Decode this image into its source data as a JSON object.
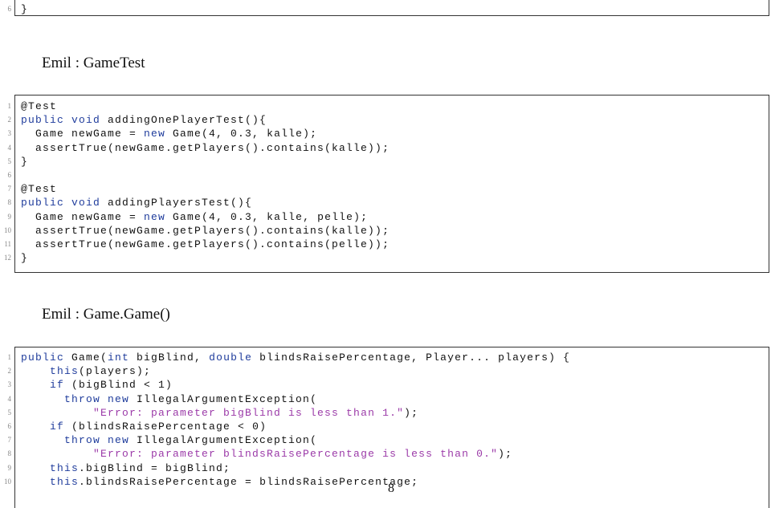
{
  "colors": {
    "keyword": "#1f3c9c",
    "string": "#9b3aa8"
  },
  "listing1": {
    "lines": [
      {
        "n": "6",
        "tokens": [
          [
            "}",
            "p"
          ]
        ]
      }
    ]
  },
  "heading1": "Emil : GameTest",
  "listing2": {
    "lines": [
      {
        "n": "1",
        "tokens": [
          [
            "@Test",
            "p"
          ]
        ]
      },
      {
        "n": "2",
        "tokens": [
          [
            "public void",
            "kw"
          ],
          [
            " addingOnePlayerTest(){",
            "p"
          ]
        ]
      },
      {
        "n": "3",
        "tokens": [
          [
            "  Game newGame = ",
            "p"
          ],
          [
            "new",
            "kw"
          ],
          [
            " Game(4, 0.3, kalle);",
            "p"
          ]
        ]
      },
      {
        "n": "4",
        "tokens": [
          [
            "  assertTrue(newGame.getPlayers().contains(kalle));",
            "p"
          ]
        ]
      },
      {
        "n": "5",
        "tokens": [
          [
            "}",
            "p"
          ]
        ]
      },
      {
        "n": "6",
        "tokens": []
      },
      {
        "n": "7",
        "tokens": [
          [
            "@Test",
            "p"
          ]
        ]
      },
      {
        "n": "8",
        "tokens": [
          [
            "public void",
            "kw"
          ],
          [
            " addingPlayersTest(){",
            "p"
          ]
        ]
      },
      {
        "n": "9",
        "tokens": [
          [
            "  Game newGame = ",
            "p"
          ],
          [
            "new",
            "kw"
          ],
          [
            " Game(4, 0.3, kalle, pelle);",
            "p"
          ]
        ]
      },
      {
        "n": "10",
        "tokens": [
          [
            "  assertTrue(newGame.getPlayers().contains(kalle));",
            "p"
          ]
        ]
      },
      {
        "n": "11",
        "tokens": [
          [
            "  assertTrue(newGame.getPlayers().contains(pelle));",
            "p"
          ]
        ]
      },
      {
        "n": "12",
        "tokens": [
          [
            "}",
            "p"
          ]
        ]
      }
    ]
  },
  "heading2": "Emil : Game.Game()",
  "listing3": {
    "lines": [
      {
        "n": "1",
        "tokens": [
          [
            "public",
            "kw"
          ],
          [
            " Game(",
            "p"
          ],
          [
            "int",
            "kw"
          ],
          [
            " bigBlind, ",
            "p"
          ],
          [
            "double",
            "kw"
          ],
          [
            " blindsRaisePercentage, Player... players) {",
            "p"
          ]
        ]
      },
      {
        "n": "2",
        "tokens": [
          [
            "    ",
            "p"
          ],
          [
            "this",
            "kw"
          ],
          [
            "(players);",
            "p"
          ]
        ]
      },
      {
        "n": "3",
        "tokens": [
          [
            "    ",
            "p"
          ],
          [
            "if",
            "kw"
          ],
          [
            " (bigBlind < 1)",
            "p"
          ]
        ]
      },
      {
        "n": "4",
        "tokens": [
          [
            "      ",
            "p"
          ],
          [
            "throw new",
            "kw"
          ],
          [
            " IllegalArgumentException(",
            "p"
          ]
        ]
      },
      {
        "n": "5",
        "tokens": [
          [
            "          ",
            "p"
          ],
          [
            "\"Error: parameter bigBlind is less than 1.\"",
            "str"
          ],
          [
            ");",
            "p"
          ]
        ]
      },
      {
        "n": "6",
        "tokens": [
          [
            "    ",
            "p"
          ],
          [
            "if",
            "kw"
          ],
          [
            " (blindsRaisePercentage < 0)",
            "p"
          ]
        ]
      },
      {
        "n": "7",
        "tokens": [
          [
            "      ",
            "p"
          ],
          [
            "throw new",
            "kw"
          ],
          [
            " IllegalArgumentException(",
            "p"
          ]
        ]
      },
      {
        "n": "8",
        "tokens": [
          [
            "          ",
            "p"
          ],
          [
            "\"Error: parameter blindsRaisePercentage is less than 0.\"",
            "str"
          ],
          [
            ");",
            "p"
          ]
        ]
      },
      {
        "n": "9",
        "tokens": [
          [
            "    ",
            "p"
          ],
          [
            "this",
            "kw"
          ],
          [
            ".bigBlind = bigBlind;",
            "p"
          ]
        ]
      },
      {
        "n": "10",
        "tokens": [
          [
            "    ",
            "p"
          ],
          [
            "this",
            "kw"
          ],
          [
            ".blindsRaisePercentage = blindsRaisePercentage;",
            "p"
          ]
        ]
      }
    ]
  },
  "page_number": "8"
}
